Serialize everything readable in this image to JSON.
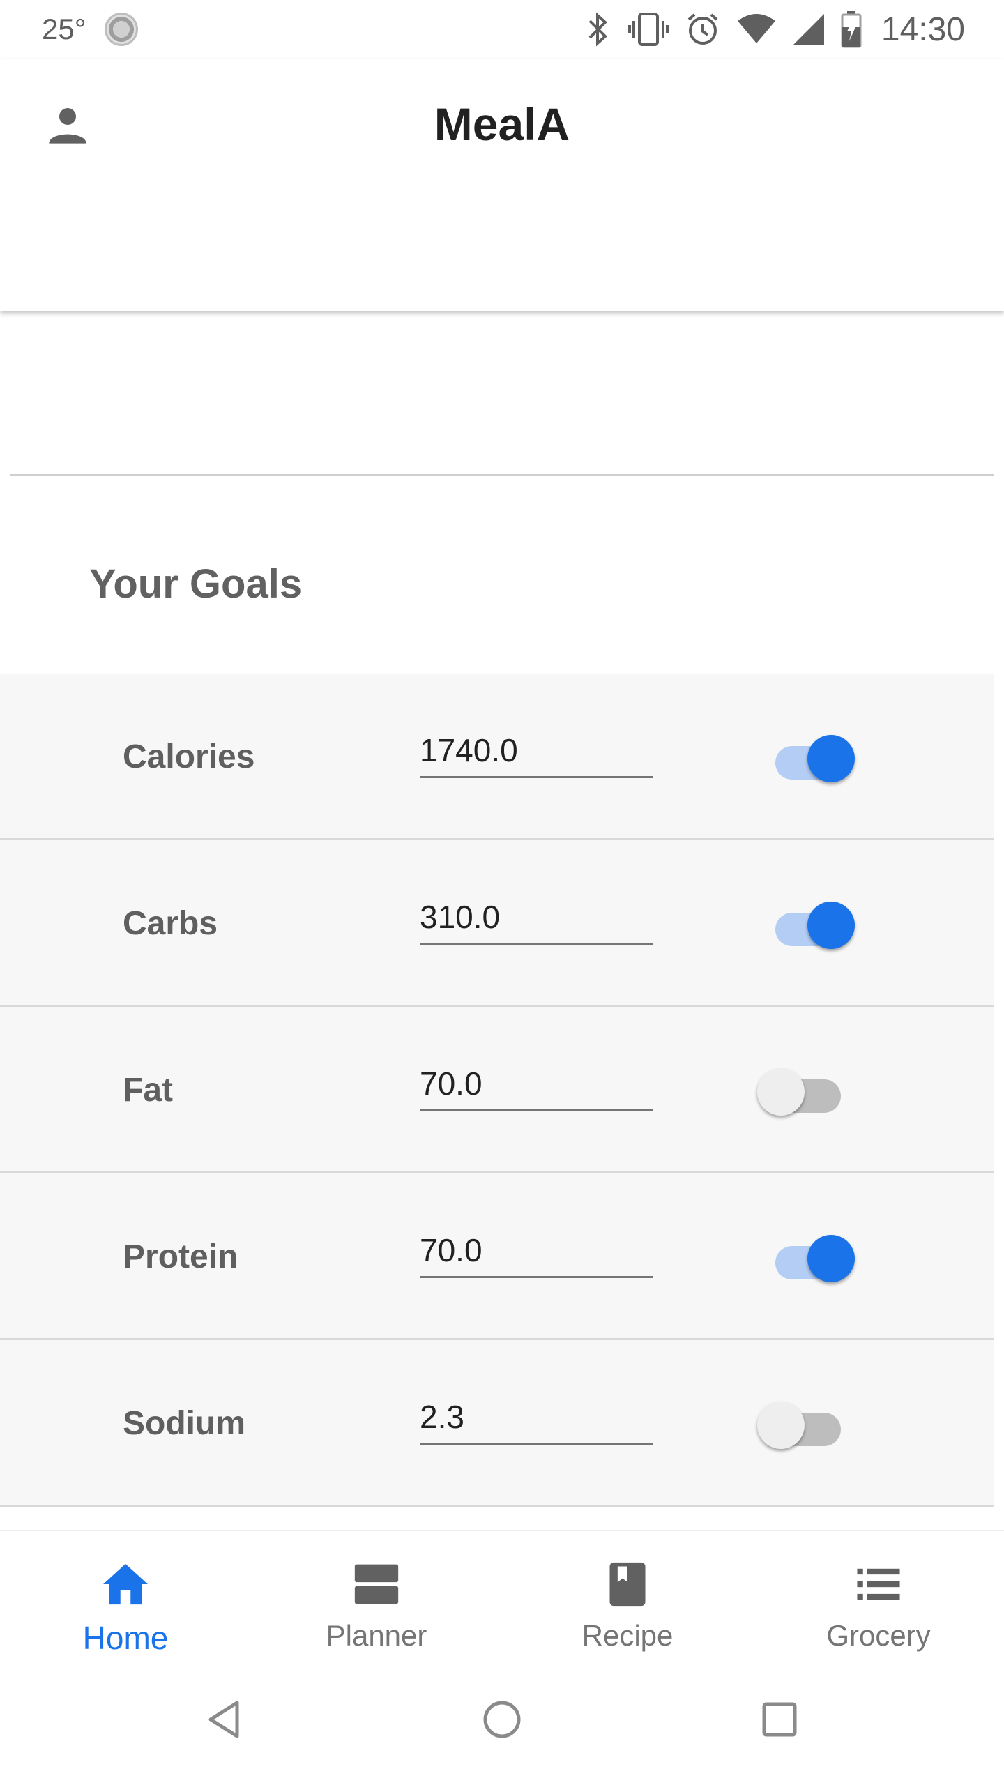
{
  "status_bar": {
    "temperature": "25°",
    "time": "14:30",
    "icons": [
      "weather-icon",
      "bluetooth-icon",
      "vibrate-icon",
      "alarm-icon",
      "wifi-icon",
      "signal-icon",
      "battery-icon"
    ]
  },
  "app_bar": {
    "title": "MealA",
    "profile_icon": "person-icon"
  },
  "section": {
    "title": "Your Goals"
  },
  "goals": [
    {
      "label": "Calories",
      "value": "1740.0",
      "enabled": true
    },
    {
      "label": "Carbs",
      "value": "310.0",
      "enabled": true
    },
    {
      "label": "Fat",
      "value": "70.0",
      "enabled": false
    },
    {
      "label": "Protein",
      "value": "70.0",
      "enabled": true
    },
    {
      "label": "Sodium",
      "value": "2.3",
      "enabled": false
    }
  ],
  "bottom_nav": {
    "items": [
      {
        "label": "Home",
        "icon": "home-icon",
        "active": true
      },
      {
        "label": "Planner",
        "icon": "planner-icon",
        "active": false
      },
      {
        "label": "Recipe",
        "icon": "book-icon",
        "active": false
      },
      {
        "label": "Grocery",
        "icon": "list-icon",
        "active": false
      }
    ]
  },
  "colors": {
    "accent": "#1a73e8",
    "accent_track": "#b3cdf5",
    "label_gray": "#5f5f5f",
    "row_bg": "#f7f7f7"
  }
}
